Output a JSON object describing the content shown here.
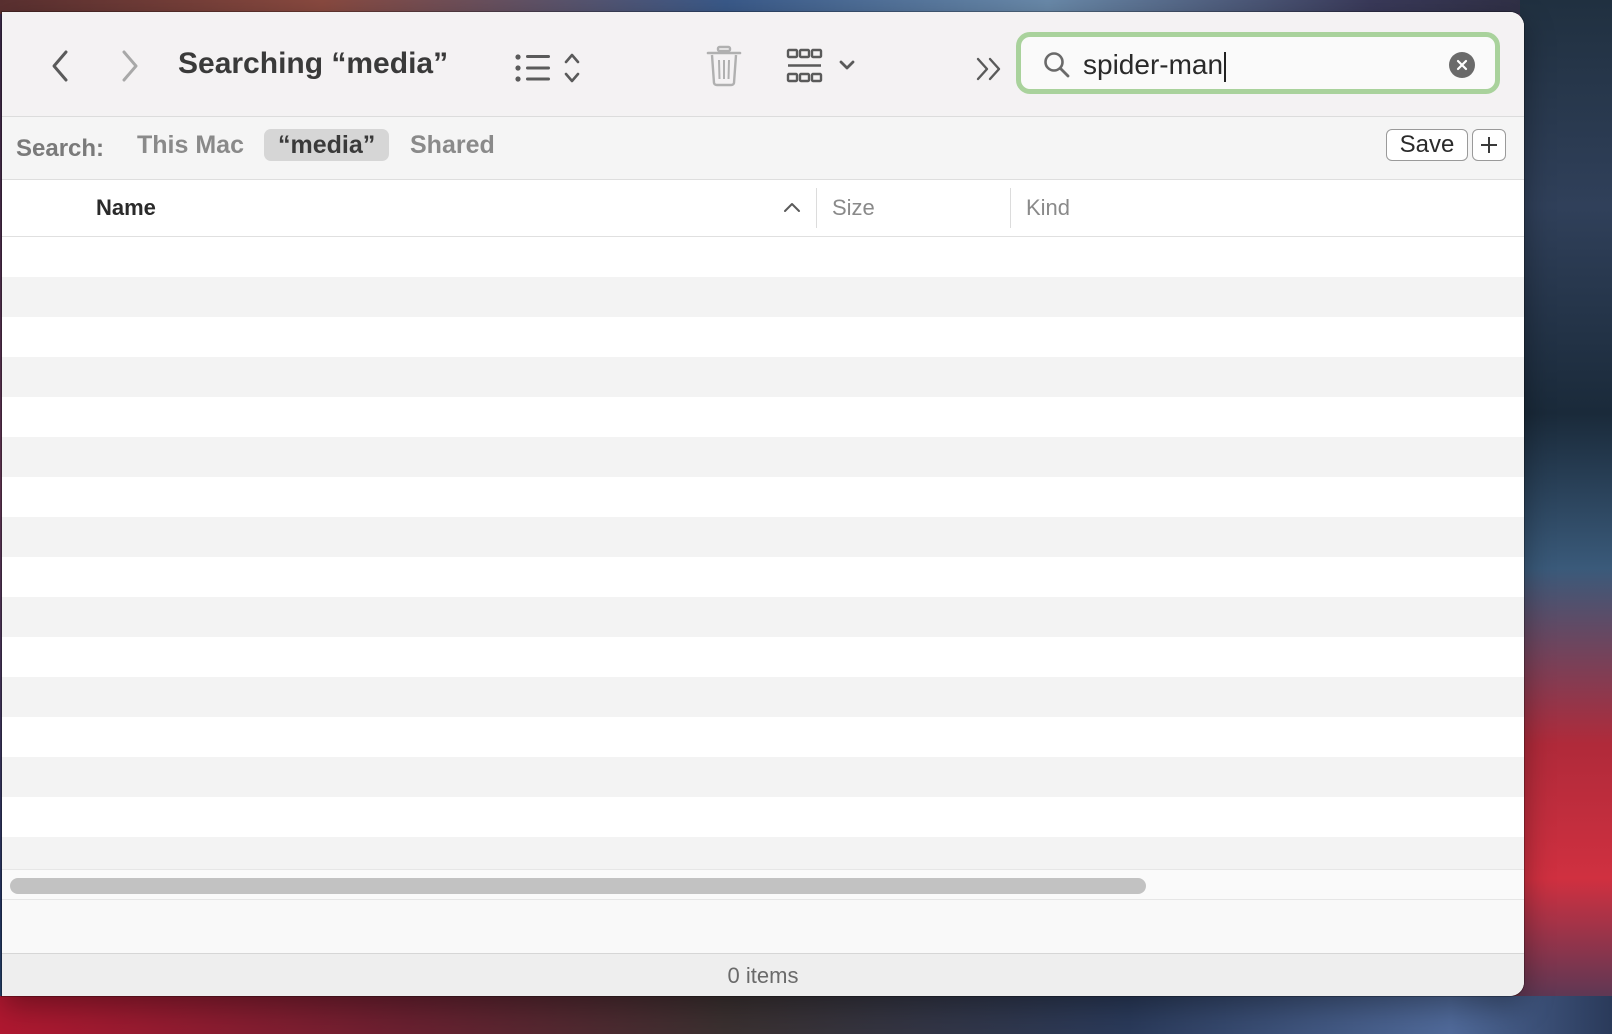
{
  "window": {
    "title": "Searching “media”"
  },
  "toolbar": {
    "back_icon": "chevron-left-icon",
    "forward_icon": "chevron-right-icon",
    "list_view_icon": "list-view-icon",
    "delete_icon": "trash-icon",
    "group_icon": "group-by-icon",
    "overflow_icon": "double-chevron-right-icon"
  },
  "search": {
    "value": "spider-man",
    "focus_ring_color": "#a9d29c"
  },
  "scope": {
    "label": "Search:",
    "items": [
      "This Mac",
      "“media”",
      "Shared"
    ],
    "selected": "“media”",
    "save_label": "Save"
  },
  "columns": {
    "name": "Name",
    "size": "Size",
    "kind": "Kind"
  },
  "status": {
    "item_count": "0 items"
  }
}
